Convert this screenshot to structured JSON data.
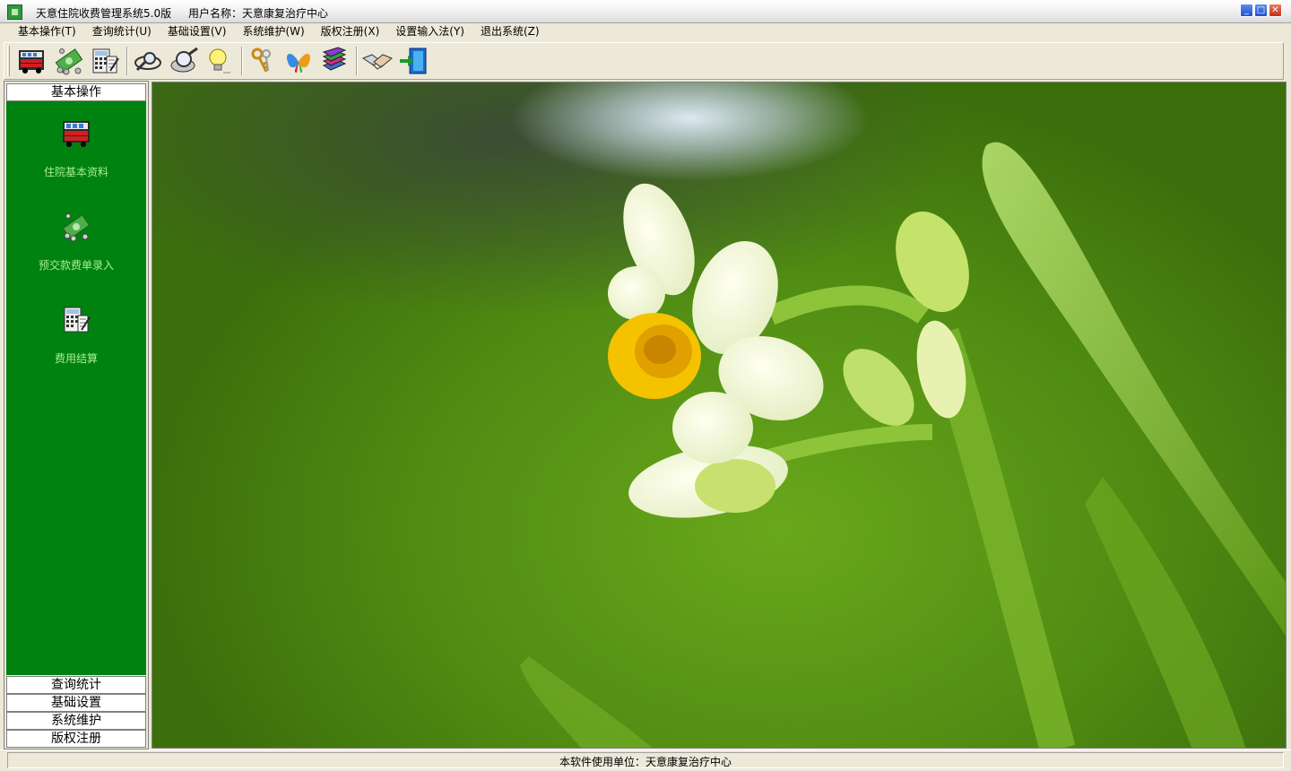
{
  "window": {
    "title": "天意住院收费管理系统5.0版",
    "user_label": "用户名称：天意康复治疗中心",
    "controls": [
      "minimize",
      "maximize",
      "close"
    ]
  },
  "menubar": {
    "items": [
      {
        "label": "基本操作(T)"
      },
      {
        "label": "查询统计(U)"
      },
      {
        "label": "基础设置(V)"
      },
      {
        "label": "系统维护(W)"
      },
      {
        "label": "版权注册(X)"
      },
      {
        "label": "设置输入法(Y)"
      },
      {
        "label": "退出系统(Z)"
      }
    ]
  },
  "toolbar": {
    "buttons": [
      {
        "icon": "bus-icon"
      },
      {
        "icon": "money-icon"
      },
      {
        "icon": "calculator-icon"
      },
      {
        "icon": "magnifier-icon"
      },
      {
        "icon": "search-disk-icon"
      },
      {
        "icon": "lightbulb-icon"
      },
      {
        "icon": "keys-icon"
      },
      {
        "icon": "butterfly-icon"
      },
      {
        "icon": "books-icon"
      },
      {
        "icon": "handshake-icon"
      },
      {
        "icon": "exit-door-icon"
      }
    ]
  },
  "sidebar": {
    "active_group": "基本操作",
    "items": [
      {
        "label": "住院基本资料",
        "icon": "bus-icon"
      },
      {
        "label": "预交款费单录入",
        "icon": "money-icon"
      },
      {
        "label": "费用结算",
        "icon": "calculator-icon"
      }
    ],
    "groups": [
      "查询统计",
      "基础设置",
      "系统维护",
      "版权注册"
    ],
    "panel_color": "#008211",
    "label_color": "#a7ef8a"
  },
  "statusbar": {
    "text": "本软件使用单位：天意康复治疗中心"
  }
}
